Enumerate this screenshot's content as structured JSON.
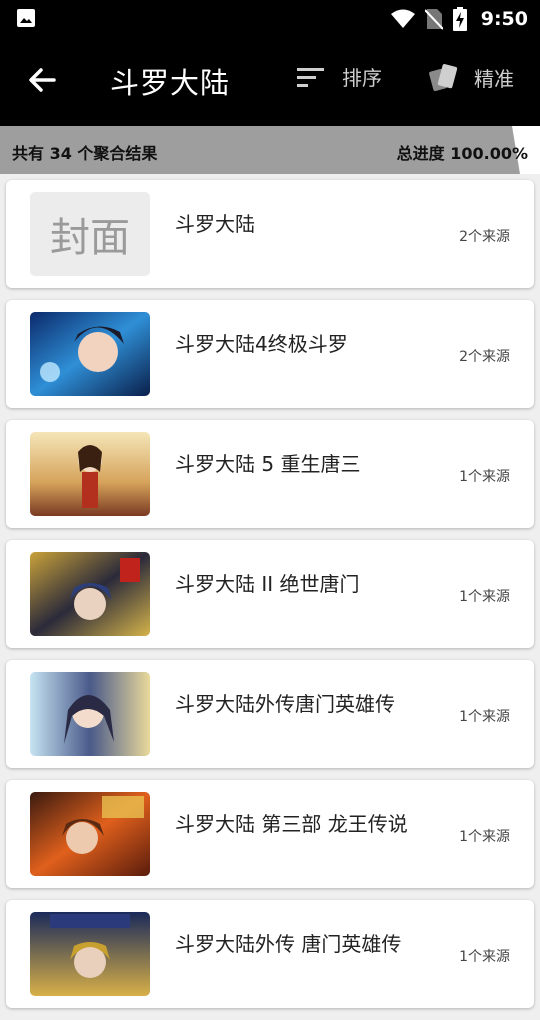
{
  "status_bar": {
    "time": "9:50"
  },
  "toolbar": {
    "title": "斗罗大陆",
    "sort_label": "排序",
    "precise_label": "精准"
  },
  "progress": {
    "summary": "共有 34 个聚合结果",
    "total": "总进度 100.00%",
    "fraction": 1.0
  },
  "cover_placeholder": "封面",
  "results": [
    {
      "name": "斗罗大陆",
      "sources": "2个来源",
      "cover": "placeholder"
    },
    {
      "name": "斗罗大陆4终极斗罗",
      "sources": "2个来源",
      "cover": "image"
    },
    {
      "name": "斗罗大陆 5 重生唐三",
      "sources": "1个来源",
      "cover": "image"
    },
    {
      "name": "斗罗大陆 II 绝世唐门",
      "sources": "1个来源",
      "cover": "image"
    },
    {
      "name": "斗罗大陆外传唐门英雄传",
      "sources": "1个来源",
      "cover": "image"
    },
    {
      "name": "斗罗大陆 第三部 龙王传说",
      "sources": "1个来源",
      "cover": "image"
    },
    {
      "name": "斗罗大陆外传 唐门英雄传",
      "sources": "1个来源",
      "cover": "image"
    }
  ],
  "colors": {
    "bar_bg": "#000000",
    "progress_fill": "#9e9e9e",
    "card_bg": "#ffffff"
  }
}
